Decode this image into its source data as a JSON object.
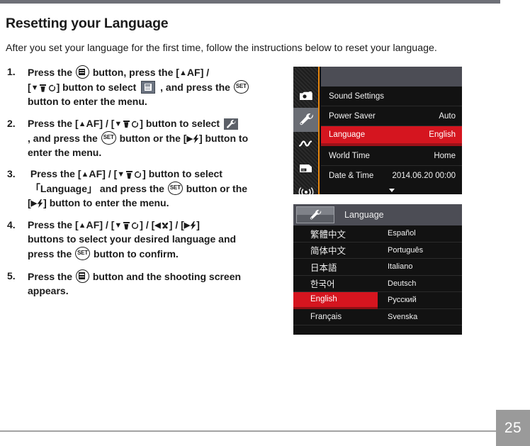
{
  "document": {
    "title": "Resetting your Language",
    "intro": "After you set your language for the first time, follow the instructions below to reset your language.",
    "page_number": "25"
  },
  "steps": [
    {
      "num": "1.",
      "parts": [
        {
          "t": "text",
          "v": "Press the "
        },
        {
          "t": "icon",
          "v": "menu-button-icon"
        },
        {
          "t": "text",
          "v": " button, press the "
        },
        {
          "t": "key",
          "v": "[▲AF]"
        },
        {
          "t": "text",
          "v": " / "
        },
        {
          "t": "key",
          "v": "[▼🗑↺]"
        },
        {
          "t": "text",
          "v": " button to select "
        },
        {
          "t": "icon",
          "v": "menu-chip-icon"
        },
        {
          "t": "text",
          "v": " , and press the "
        },
        {
          "t": "icon",
          "v": "set-button-icon"
        },
        {
          "t": "text",
          "v": " button to enter the menu."
        }
      ],
      "plain": "Press the MENU button, press the [▲AF] / [▼🗑↺] button to select [menu], and press the SET button to enter the menu."
    },
    {
      "num": "2.",
      "plain": "Press the [▲AF] / [▼🗑↺] button to select [wrench] , and press the SET button or the [▶⚡] button to enter the menu."
    },
    {
      "num": "3.",
      "plain": "Press the [▲AF] / [▼🗑↺] button to select 「Language」 and press the SET button or the [▶⚡] button to enter the menu."
    },
    {
      "num": "4.",
      "plain": "Press the [▲AF] / [▼🗑↺] / [◀✿] / [▶⚡] buttons to select your desired language and press the SET button to confirm."
    },
    {
      "num": "5.",
      "plain": "Press the MENU button and the shooting screen appears."
    }
  ],
  "step_text": {
    "press_the": "Press the",
    "button_comma": "button, press the",
    "button_to_select": "button to select",
    "and_press_the": ", and press the",
    "button_to_enter_menu": "button to enter the menu.",
    "s2_and_press_the": ", and press the",
    "s2_button_or_the": "button or the",
    "s2_button_to": "button to",
    "s2_enter_the_menu": "enter the menu.",
    "s3_button_to_select": "button to select",
    "s3_language_quoted": "「Language」",
    "s3_and_press_the": "and press the",
    "s3_button_or_the": "button or the",
    "s3_button_to_enter": "button to enter the menu.",
    "s4_buttons_to_select": "buttons to select your desired language and",
    "s4_press_the": "press the",
    "s4_button_to_confirm": "button to confirm.",
    "s5_button_and": "button and the shooting screen",
    "s5_appears": "appears.",
    "set_label": "SET",
    "key_up": "▲AF",
    "key_down": "▼",
    "key_right": "▶",
    "key_left": "◀",
    "bracket_open": "[",
    "bracket_close": "]",
    "slash": "/"
  },
  "settings_menu": {
    "sidebar": [
      {
        "name": "camera-tab",
        "icon": "camera-icon",
        "active": false
      },
      {
        "name": "setup-tab",
        "icon": "wrench-icon",
        "active": true
      },
      {
        "name": "custom-tab",
        "icon": "wave-icon",
        "active": false
      },
      {
        "name": "file-tab",
        "icon": "sd-card-icon",
        "active": false
      },
      {
        "name": "wireless-tab",
        "icon": "wifi-icon",
        "active": false
      }
    ],
    "rows": [
      {
        "label": "Sound Settings",
        "value": "",
        "selected": false
      },
      {
        "label": "Power Saver",
        "value": "Auto",
        "selected": false
      },
      {
        "label": "Language",
        "value": "English",
        "selected": true
      },
      {
        "label": "World Time",
        "value": "Home",
        "selected": false
      },
      {
        "label": "Date & Time",
        "value": "2014.06.20 00:00",
        "selected": false
      }
    ],
    "scroll_indicator": "▼",
    "highlight_color": "#d5151f",
    "accent_color": "#e8860c"
  },
  "language_screen": {
    "title": "Language",
    "tab_icon": "wrench-icon",
    "left_column": [
      {
        "label": "繁體中文",
        "selected": false,
        "cjk": true
      },
      {
        "label": "简体中文",
        "selected": false,
        "cjk": true
      },
      {
        "label": "日本語",
        "selected": false,
        "cjk": true
      },
      {
        "label": "한국어",
        "selected": false,
        "cjk": true
      },
      {
        "label": "English",
        "selected": true,
        "cjk": false
      },
      {
        "label": "Français",
        "selected": false,
        "cjk": false
      }
    ],
    "right_column": [
      {
        "label": "Español",
        "selected": false
      },
      {
        "label": "Português",
        "selected": false
      },
      {
        "label": "Italiano",
        "selected": false
      },
      {
        "label": "Deutsch",
        "selected": false
      },
      {
        "label": "Русский",
        "selected": false
      },
      {
        "label": "Svenska",
        "selected": false
      }
    ],
    "highlight_color": "#d5151f"
  }
}
